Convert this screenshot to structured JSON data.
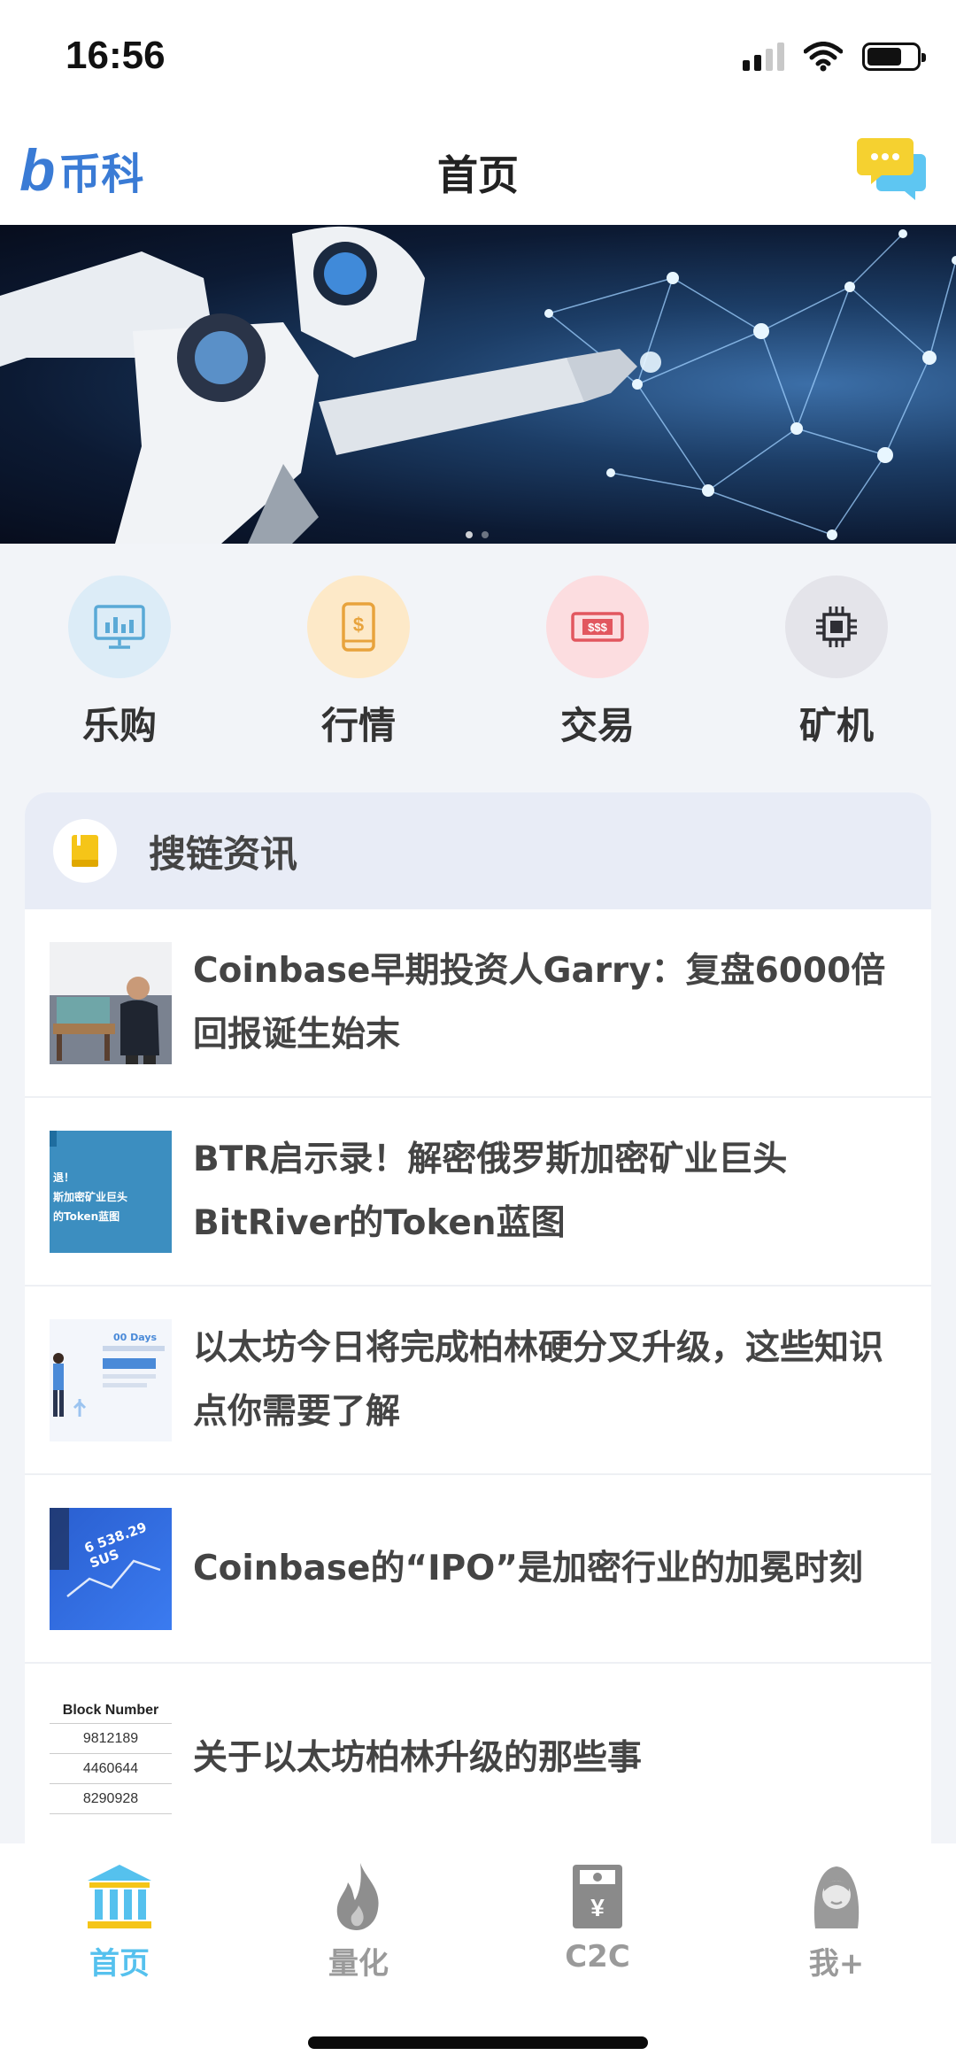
{
  "status_bar": {
    "time": "16:56"
  },
  "header": {
    "logo_text": "币科",
    "title": "首页"
  },
  "quick_menu": [
    {
      "label": "乐购",
      "icon": "monitor-chart-icon",
      "bg": "#dcecf7",
      "fg": "#5aa9d6"
    },
    {
      "label": "行情",
      "icon": "phone-dollar-icon",
      "bg": "#fde9c8",
      "fg": "#e8a33c"
    },
    {
      "label": "交易",
      "icon": "cash-ticket-icon",
      "bg": "#fcdde0",
      "fg": "#e2575f"
    },
    {
      "label": "矿机",
      "icon": "chip-icon",
      "bg": "#e4e4ea",
      "fg": "#2e2e34"
    }
  ],
  "news": {
    "section_title": "搜链资讯",
    "items": [
      {
        "title": "Coinbase早期投资人Garry：复盘6000倍回报诞生始末"
      },
      {
        "title": "BTR启示录！解密俄罗斯加密矿业巨头BitRiver的Token蓝图",
        "thumb_text": [
          "退！",
          "斯加密矿业巨头",
          "的Token蓝图"
        ]
      },
      {
        "title": "以太坊今日将完成柏林硬分叉升级，这些知识点你需要了解",
        "thumb_text": "00 Days"
      },
      {
        "title": "Coinbase的“IPO”是加密行业的加冕时刻",
        "thumb_text": "6 538.29 SUS"
      },
      {
        "title": "关于以太坊柏林升级的那些事",
        "thumb_text": {
          "header": "Block Number",
          "rows": [
            "9812189",
            "4460644",
            "8290928"
          ]
        }
      }
    ]
  },
  "tabs": [
    {
      "label": "首页",
      "icon": "bank-icon",
      "active": true
    },
    {
      "label": "量化",
      "icon": "flame-icon",
      "active": false
    },
    {
      "label": "C2C",
      "icon": "yen-card-icon",
      "active": false
    },
    {
      "label": "我+",
      "icon": "profile-icon",
      "active": false
    }
  ],
  "colors": {
    "brand": "#3a7bd5",
    "tab_active": "#55c1ee",
    "tab_inactive": "#9a9a9a",
    "chat": "#f5d130"
  }
}
